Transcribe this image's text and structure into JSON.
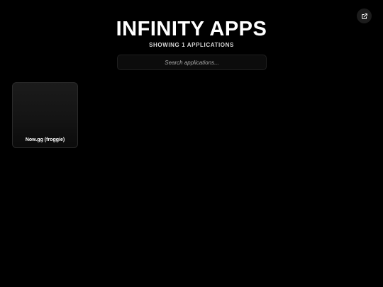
{
  "header": {
    "title": "INFINITY APPS",
    "subtitle": "SHOWING 1 APPLICATIONS"
  },
  "search": {
    "placeholder": "Search applications..."
  },
  "apps": [
    {
      "name": "Now.gg (froggie)"
    }
  ],
  "icons": {
    "open_external": "external-link-icon"
  },
  "colors": {
    "background": "#000000",
    "card_border": "#2a2a2a",
    "button_bg": "#1c1c1c"
  }
}
